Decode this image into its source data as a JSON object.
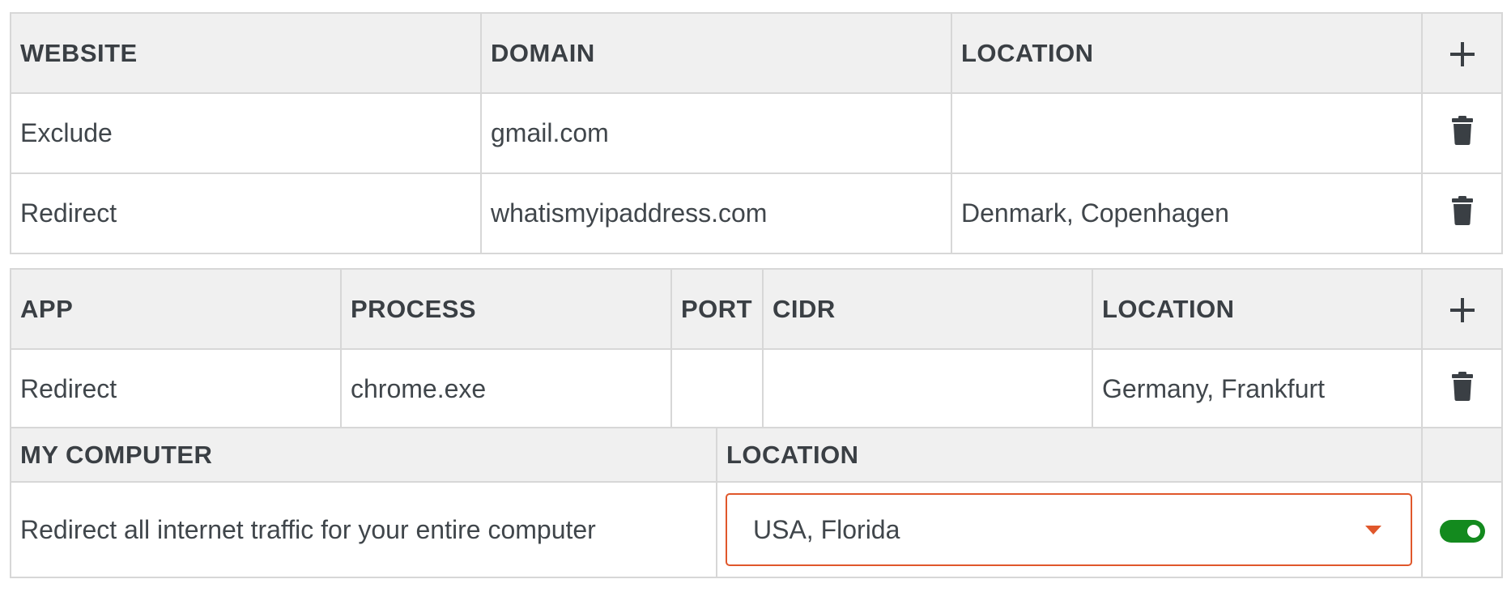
{
  "websites_table": {
    "headers": {
      "website": "WEBSITE",
      "domain": "DOMAIN",
      "location": "LOCATION"
    },
    "add_icon": "plus-icon",
    "rows": [
      {
        "website": "Exclude",
        "domain": "gmail.com",
        "location": "",
        "delete_icon": "trash-icon"
      },
      {
        "website": "Redirect",
        "domain": "whatismyipaddress.com",
        "location": "Denmark, Copenhagen",
        "delete_icon": "trash-icon"
      }
    ]
  },
  "apps_table": {
    "headers": {
      "app": "APP",
      "process": "PROCESS",
      "port": "PORT",
      "cidr": "CIDR",
      "location": "LOCATION"
    },
    "add_icon": "plus-icon",
    "rows": [
      {
        "app": "Redirect",
        "process": "chrome.exe",
        "port": "",
        "cidr": "",
        "location": "Germany, Frankfurt",
        "delete_icon": "trash-icon"
      }
    ]
  },
  "computer_table": {
    "headers": {
      "my_computer": "MY COMPUTER",
      "location": "LOCATION"
    },
    "description": "Redirect all internet traffic for your entire computer",
    "location_select": {
      "selected": "USA, Florida",
      "caret_icon": "caret-down-icon"
    },
    "toggle": {
      "on": true,
      "color": "#138a1e"
    }
  },
  "colors": {
    "header_bg": "#f0f0f0",
    "border": "#d7d7d7",
    "accent": "#e0572b",
    "text": "#40464b"
  }
}
